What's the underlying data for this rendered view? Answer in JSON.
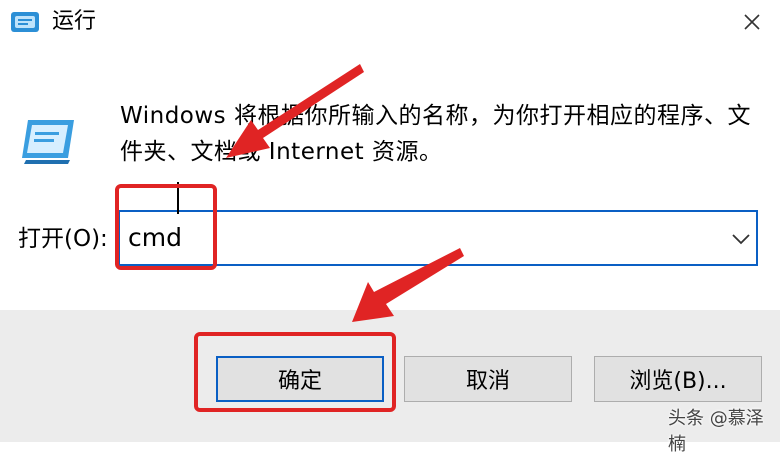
{
  "window": {
    "title": "运行"
  },
  "description": "Windows 将根据你所输入的名称，为你打开相应的程序、文件夹、文档或 Internet 资源。",
  "open_field": {
    "label": "打开(O):",
    "value": "cmd"
  },
  "buttons": {
    "ok": "确定",
    "cancel": "取消",
    "browse": "浏览(B)..."
  },
  "watermark": "头条 @慕泽楠",
  "colors": {
    "accent": "#0a5fc4",
    "annotation": "#e02424",
    "footer": "#ececec"
  },
  "icons": {
    "app": "run-icon",
    "close": "close-icon",
    "dropdown": "chevron-down-icon"
  }
}
